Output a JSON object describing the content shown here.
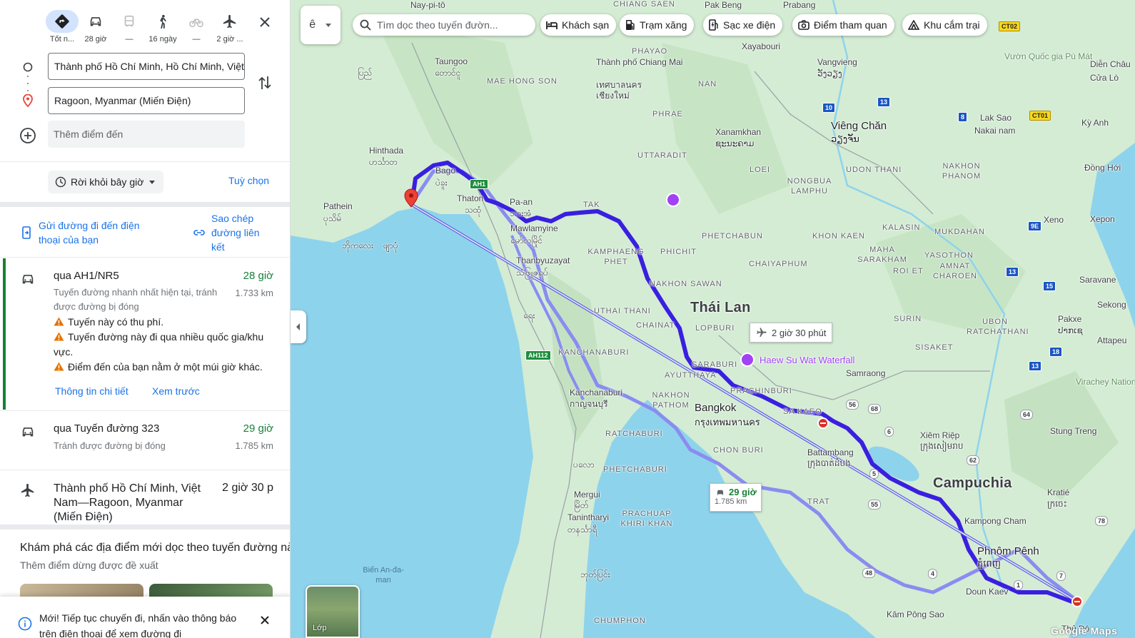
{
  "travel_modes": [
    {
      "name": "best",
      "label": "Tốt n...",
      "selected": true
    },
    {
      "name": "car",
      "label": "28 giờ"
    },
    {
      "name": "transit",
      "label": "—"
    },
    {
      "name": "walk",
      "label": "16 ngày"
    },
    {
      "name": "bike",
      "label": "—"
    },
    {
      "name": "flight",
      "label": "2 giờ ..."
    }
  ],
  "origin": "Thành phố Hồ Chí Minh, Hồ Chí Minh, Việt Nam",
  "destination": "Ragoon, Myanmar (Miến Điện)",
  "add_destination": "Thêm điểm đến",
  "depart_label": "Rời khỏi bây giờ",
  "options_label": "Tuỳ chọn",
  "send_phone": "Gửi đường đi đến điện thoại của bạn",
  "copy_link": "Sao chép đường liên kết",
  "routes": [
    {
      "name": "qua AH1/NR5",
      "time": "28 giờ",
      "distance": "1.733 km",
      "desc": "Tuyến đường nhanh nhất hiện tại, tránh được đường bị đóng",
      "warnings": [
        "Tuyến này có thu phí.",
        "Tuyến đường này đi qua nhiều quốc gia/khu vực.",
        "Điểm đến của bạn nằm ở một múi giờ khác."
      ],
      "details_label": "Thông tin chi tiết",
      "preview_label": "Xem trước"
    },
    {
      "name": "qua Tuyến đường 323",
      "time": "29 giờ",
      "distance": "1.785 km",
      "desc": "Tránh được đường bị đóng"
    }
  ],
  "flight": {
    "name": "Thành phố Hồ Chí Minh, Việt Nam—Ragoon, Myanmar (Miến Điện)",
    "time": "2 giờ 30 p"
  },
  "explore_title": "Khám phá các địa điểm mới dọc theo tuyến đường này",
  "explore_sub": "Thêm điểm dừng được đề xuất",
  "toast": "Mới! Tiếp tục chuyến đi, nhấn vào thông báo",
  "toast_sub": "trên điện thoại để xem đường đi",
  "map": {
    "search_placeholder": "Tìm dọc theo tuyến đườn...",
    "layers_glyph": "ê",
    "chips": [
      "Khách sạn",
      "Trạm xăng",
      "Sạc xe điện",
      "Điểm tham quan",
      "Khu cắm trại"
    ],
    "flight_callout": "2 giờ 30 phút",
    "alt_callout_time": "29 giờ",
    "alt_callout_dist": "1.785 km",
    "layers_label": "Lớp",
    "attribution": "Google Maps",
    "colors": {
      "water": "#8ed3ec",
      "land": "#d4ecd4",
      "route_main": "#3a1fe0",
      "route_alt": "#8a8cf0"
    },
    "labels": {
      "countries": [
        "Thái Lan",
        "Campuchia"
      ],
      "cities": [
        "Bangkok",
        "กรุงเทพมหานคร",
        "Phnôm Pênh",
        "ភ្នំពេញ",
        "Viêng Chăn",
        "ວຽງຈັນ"
      ],
      "towns": [
        "Nay-pi-tô",
        "Taungoo",
        "တောင်ငူ",
        "Hinthada",
        "ဟင်္သာတ",
        "Pathein",
        "ပုသိမ်",
        "Bago",
        "ပဲခူး",
        "Thaton",
        "သထုံ",
        "Pa-an",
        "ဘားအံ",
        "Mawlamyine",
        "မော်လမြိုင်",
        "Thanbyuzayat",
        "သံဖြူဇရပ်",
        "Thành phố Chiang Mai",
        "เทศบาลนคร",
        "เชียงใหม่",
        "Xayabouri",
        "Vangvieng",
        "ວັງວຽງ",
        "Xanamkhan",
        "ຊະນະຄາມ",
        "Kanchanaburi",
        "กาญจนบุรี",
        "Mergui",
        "မြိတ်",
        "Tanintharyi",
        "တနင်္သာရီ",
        "Battambang",
        "ក្រុងបាត់ដំបង",
        "Samraong",
        "Xiêm Riệp",
        "ក្រុងសៀមរាប",
        "Stung Treng",
        "Kratié",
        "ក្រចេះ",
        "Kampong Cham",
        "Doun Kaev",
        "Kâm Pông Sao",
        "Pakxe",
        "ປາກເຊ",
        "Saravane",
        "Xeno",
        "Xepon",
        "Lak Sao",
        "Nakai nam",
        "Virachey National Par",
        "Attapeu",
        "Sekong",
        "Vườn Quốc gia Pù Mát",
        "Diễn Châu",
        "Cửa Lò",
        "Kỳ Anh",
        "Đồng Hới",
        "Prabang",
        "Pak Beng",
        "ပြည်",
        "ဘိုကလေး",
        "ဖျာပုံ",
        "ရေး",
        "ဘုတ်ပြင်း",
        "ပလော",
        "Thủ Đô"
      ],
      "provinces": [
        "PHAYAO",
        "MAE HONG SON",
        "NAN",
        "PHRAE",
        "UTTARADIT",
        "LOEI",
        "UDON THANI",
        "NONGBUA LAMPHU",
        "NAKHON PHANOM",
        "TAK",
        "KAMPHAENG PHET",
        "PHICHIT",
        "PHETCHABUN",
        "KHON KAEN",
        "KALASIN",
        "MUKDAHAN",
        "MAHA SARAKHAM",
        "YASOTHON",
        "AMNAT CHAROEN",
        "ROI ET",
        "CHAIYAPHUM",
        "NAKHON SAWAN",
        "UTHAI THANI",
        "CHAINAT",
        "LOPBURI",
        "SARABURI",
        "AYUTTHAYA",
        "PRACHINBURI",
        "SA KAEO",
        "NAKHON PATHOM",
        "RATCHABURI",
        "PHETCHABURI",
        "CHON BURI",
        "TRAT",
        "PRACHUAP KHIRI KHAN",
        "CHUMPHON",
        "KANCHANABURI",
        "SURIN",
        "SISAKET",
        "UBON RATCHATHANI",
        "CHIANG SAEN"
      ],
      "poi": [
        "Haew Su Wat Waterfall"
      ],
      "sea": [
        "Biển An-đa-man"
      ]
    },
    "shields": [
      "AH1",
      "AH112",
      "CT02",
      "CT01",
      "10",
      "13",
      "8",
      "9E",
      "13",
      "15",
      "18",
      "13",
      "56",
      "68",
      "6",
      "64",
      "62",
      "5",
      "55",
      "48",
      "4",
      "7",
      "78",
      "1"
    ]
  }
}
